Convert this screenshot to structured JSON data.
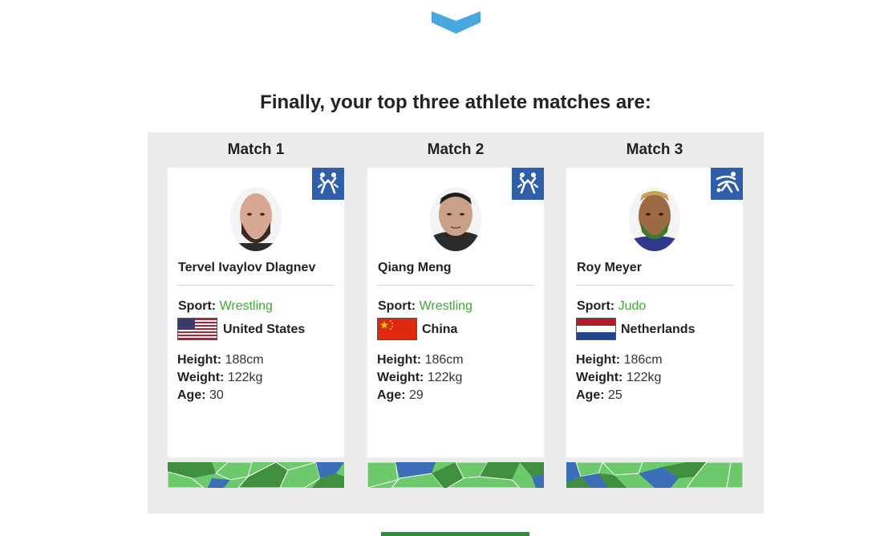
{
  "headline": "Finally, your top three athlete matches are:",
  "accent_color": "#3aaa35",
  "matches": [
    {
      "title": "Match 1",
      "sport_icon": "wrestling-icon",
      "name": "Tervel Ivaylov Dlagnev",
      "sport_label": "Sport:",
      "sport": "Wrestling",
      "country": "United States",
      "flag": "us-flag",
      "height_label": "Height:",
      "height": "188cm",
      "weight_label": "Weight:",
      "weight": "122kg",
      "age_label": "Age:",
      "age": "30"
    },
    {
      "title": "Match 2",
      "sport_icon": "wrestling-icon",
      "name": "Qiang Meng",
      "sport_label": "Sport:",
      "sport": "Wrestling",
      "country": "China",
      "flag": "china-flag",
      "height_label": "Height:",
      "height": "186cm",
      "weight_label": "Weight:",
      "weight": "122kg",
      "age_label": "Age:",
      "age": "29"
    },
    {
      "title": "Match 3",
      "sport_icon": "judo-icon",
      "name": "Roy Meyer",
      "sport_label": "Sport:",
      "sport": "Judo",
      "country": "Netherlands",
      "flag": "netherlands-flag",
      "height_label": "Height:",
      "height": "186cm",
      "weight_label": "Weight:",
      "weight": "122kg",
      "age_label": "Age:",
      "age": "25"
    }
  ]
}
